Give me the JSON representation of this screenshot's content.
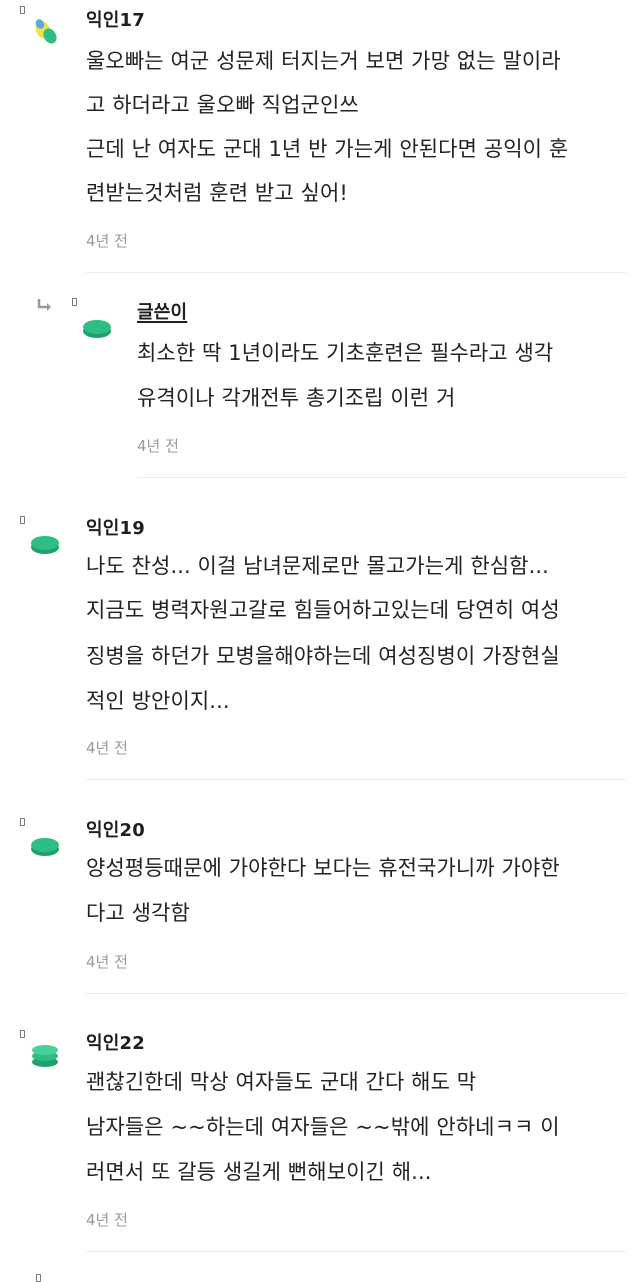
{
  "comments": [
    {
      "author": "익인17",
      "lines": [
        "울오빠는 여군 성문제 터지는거 보면 가망 없는 말이라",
        "고 하더라고 울오빠 직업군인쓰",
        "근데 난 여자도 군대 1년 반 가는게 안된다면 공익이 훈",
        "련받는것처럼 훈련 받고 싶어!"
      ],
      "time": "4년 전",
      "avatar": "yellow-blue-green-blob-avatar"
    },
    {
      "author": "글쓴이",
      "is_reply": true,
      "lines": [
        "최소한 딱 1년이라도 기초훈련은 필수라고 생각",
        "유격이나 각개전투 총기조립 이런 거"
      ],
      "time": "4년 전",
      "avatar": "green-disc-avatar"
    },
    {
      "author": "익인19",
      "lines": [
        "나도 찬성... 이걸 남녀문제로만 몰고가는게 한심함...",
        "지금도 병력자원고갈로 힘들어하고있는데 당연히 여성",
        "징병을 하던가 모병을해야하는데 여성징병이 가장현실",
        "적인 방안이지..."
      ],
      "time": "4년 전",
      "avatar": "green-disc-avatar"
    },
    {
      "author": "익인20",
      "lines": [
        "양성평등때문에 가야한다 보다는 휴전국가니까 가야한",
        "다고 생각함"
      ],
      "time": "4년 전",
      "avatar": "green-disc-avatar"
    },
    {
      "author": "익인22",
      "lines": [
        "괜찮긴한데 막상 여자들도 군대 간다 해도 막",
        "남자들은 ~~하는데 여자들은 ~~밖에 안하네ㅋㅋ 이",
        "러면서 또 갈등 생길게 뻔해보이긴 해..."
      ],
      "time": "4년 전",
      "avatar": "green-stack-avatar"
    }
  ],
  "colors": {
    "green": "#2ebd85",
    "green_dark": "#1fa06d",
    "yellow": "#f2e14a",
    "blue": "#5aa9e6",
    "text": "#222222",
    "time": "#9a9a9a"
  }
}
